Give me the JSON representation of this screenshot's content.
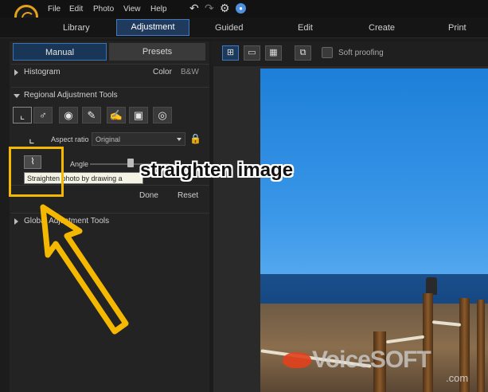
{
  "menu": {
    "file": "File",
    "edit": "Edit",
    "photo": "Photo",
    "view": "View",
    "help": "Help"
  },
  "modes": {
    "library": "Library",
    "adjustment": "Adjustment",
    "guided": "Guided",
    "edit": "Edit",
    "create": "Create",
    "print": "Print"
  },
  "panel_tabs": {
    "manual": "Manual",
    "presets": "Presets"
  },
  "histogram": {
    "label": "Histogram",
    "color": "Color",
    "bw": "B&W"
  },
  "regional": {
    "label": "Regional Adjustment Tools"
  },
  "crop": {
    "aspect_label": "Aspect ratio",
    "aspect_value": "Original",
    "angle_label": "Angle"
  },
  "tooltip": "Straighten photo by drawing a",
  "actions": {
    "done": "Done",
    "reset": "Reset"
  },
  "global": {
    "label": "Global Adjustment Tools"
  },
  "view": {
    "soft_proofing": "Soft proofing"
  },
  "caption": "straighten image",
  "watermark": {
    "brand": "VoiceSOFT",
    "domain": ".com"
  },
  "colors": {
    "accent": "#3e7bc2",
    "highlight": "#f5b800",
    "logo": "#e3a21a"
  }
}
